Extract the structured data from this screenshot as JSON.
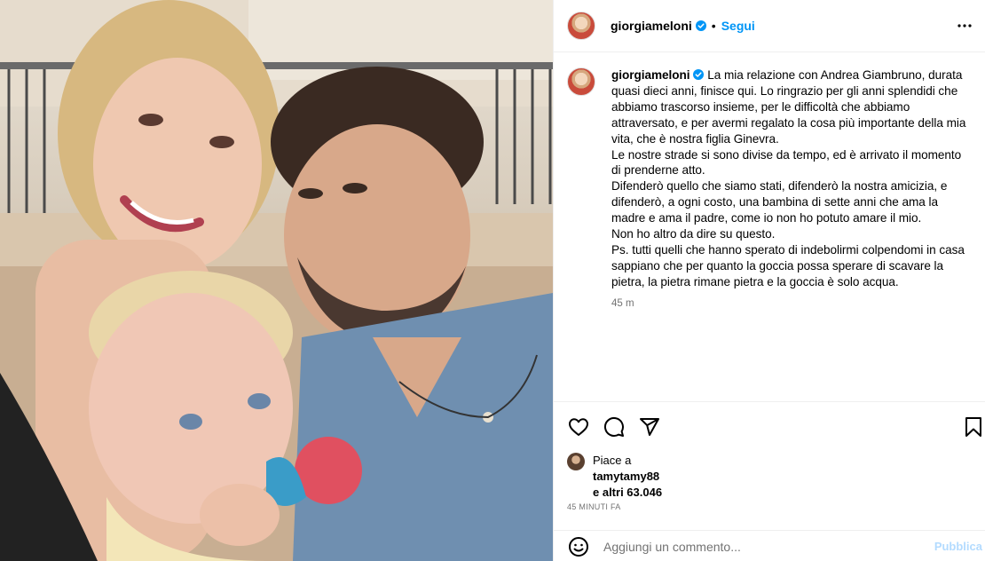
{
  "post": {
    "image_alt": "",
    "author": {
      "username": "giorgiameloni",
      "verified": true,
      "follow_label": "Segui",
      "separator": "•"
    },
    "caption": {
      "username": "giorgiameloni",
      "text": " La mia relazione con Andrea Giambruno, durata quasi dieci anni, finisce qui. Lo ringrazio per gli anni splendidi che abbiamo trascorso insieme, per le difficoltà che abbiamo attraversato, e per avermi regalato la cosa più importante della mia vita, che è nostra figlia Ginevra.\nLe nostre strade si sono divise da tempo, ed è arrivato il momento di prenderne atto.\nDifenderò quello che siamo stati, difenderò la nostra amicizia, e difenderò, a ogni costo, una bambina di sette anni che ama la madre e ama il padre, come io non ho potuto amare il mio.\nNon ho altro da dire su questo.\nPs. tutti quelli che hanno sperato di indebolirmi colpendomi in casa sappiano che per quanto la goccia possa sperare di scavare la pietra, la pietra rimane pietra e la goccia è solo acqua.",
      "time_ago": "45 m"
    },
    "actions": {
      "like_icon": "heart-icon",
      "comment_icon": "comment-icon",
      "share_icon": "send-icon",
      "save_icon": "bookmark-icon"
    },
    "likes": {
      "prefix": "Piace a",
      "liker": "tamytamy88",
      "others": "e altri 63.046"
    },
    "posted_ago": "45 MINUTI FA",
    "comment": {
      "placeholder": "Aggiungi un commento...",
      "publish_label": "Pubblica"
    }
  },
  "colors": {
    "accent": "#0095f6",
    "muted": "#737373",
    "publish_disabled": "#b3dbff",
    "border": "#efefef"
  }
}
